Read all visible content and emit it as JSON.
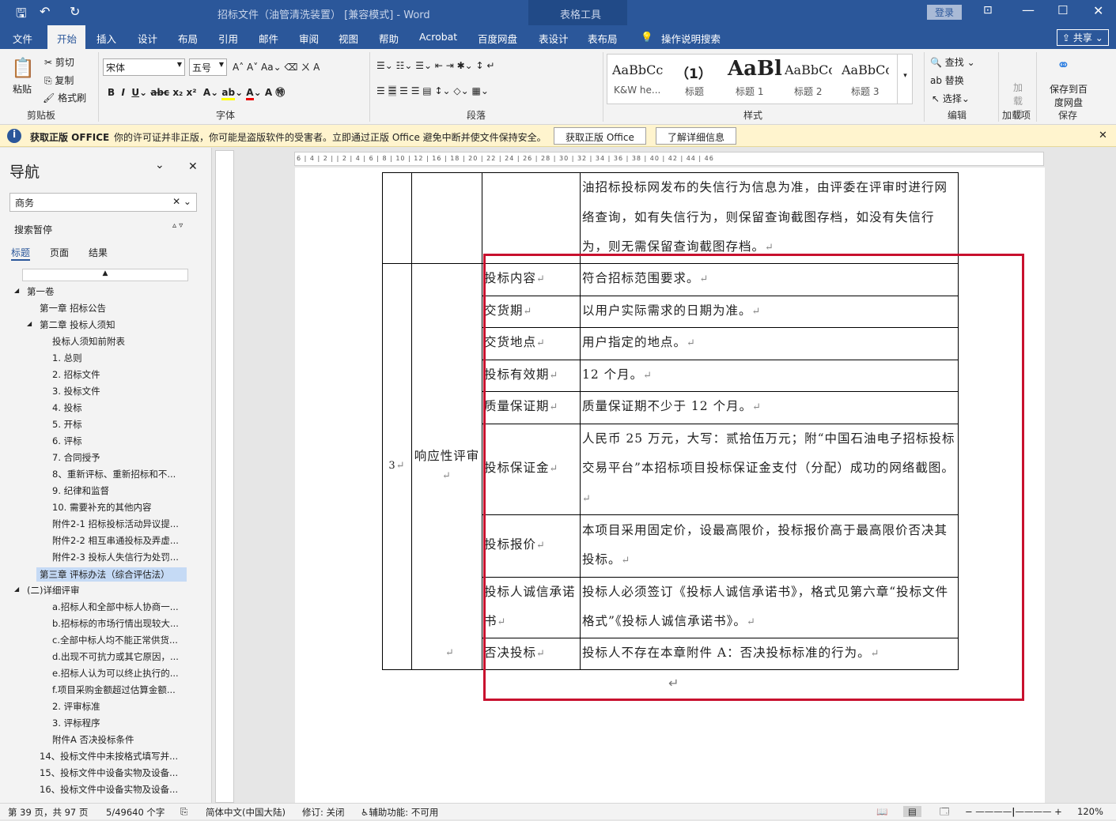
{
  "titlebar": {
    "title": "招标文件（油管清洗装置） [兼容模式] - Word",
    "context_tab": "表格工具",
    "signin": "登录"
  },
  "tabs": [
    "文件",
    "开始",
    "插入",
    "设计",
    "布局",
    "引用",
    "邮件",
    "审阅",
    "视图",
    "帮助",
    "Acrobat",
    "百度网盘",
    "表设计",
    "表布局"
  ],
  "tell_me": "操作说明搜索",
  "share": "共享",
  "ribbon": {
    "clipboard": {
      "paste": "粘贴",
      "cut": "剪切",
      "copy": "复制",
      "format_painter": "格式刷",
      "label": "剪贴板"
    },
    "font": {
      "name": "宋体",
      "size": "五号",
      "label": "字体"
    },
    "paragraph": {
      "label": "段落"
    },
    "styles": {
      "items": [
        {
          "preview": "AaBbCc",
          "name": "K&W he..."
        },
        {
          "preview": "（1）",
          "name": "标题"
        },
        {
          "preview": "AaBl",
          "name": "标题 1"
        },
        {
          "preview": "AaBbCc",
          "name": "标题 2"
        },
        {
          "preview": "AaBbCc",
          "name": "标题 3"
        }
      ],
      "label": "样式"
    },
    "editing": {
      "find": "查找",
      "replace": "替换",
      "select": "选择",
      "label": "编辑"
    },
    "addins": {
      "btn": "加载项",
      "label": "加载项"
    },
    "save": {
      "btn": "保存到百度网盘",
      "label": "保存"
    }
  },
  "infobar": {
    "title": "获取正版 OFFICE",
    "message": "你的许可证并非正版，你可能是盗版软件的受害者。立即通过正版 Office 避免中断并使文件保持安全。",
    "btn1": "获取正版 Office",
    "btn2": "了解详细信息"
  },
  "nav": {
    "title": "导航",
    "search": "商务",
    "results_label": "搜索暂停",
    "tabs": [
      "标题",
      "页面",
      "结果"
    ],
    "items": [
      {
        "t": "第一卷",
        "l": 0,
        "exp": true
      },
      {
        "t": "第一章  招标公告",
        "l": 1
      },
      {
        "t": "第二章  投标人须知",
        "l": 1,
        "exp": true
      },
      {
        "t": "投标人须知前附表",
        "l": 2
      },
      {
        "t": "1. 总则",
        "l": 2
      },
      {
        "t": "2. 招标文件",
        "l": 2
      },
      {
        "t": "3. 投标文件",
        "l": 2
      },
      {
        "t": "4. 投标",
        "l": 2
      },
      {
        "t": "5. 开标",
        "l": 2
      },
      {
        "t": "6. 评标",
        "l": 2
      },
      {
        "t": "7. 合同授予",
        "l": 2
      },
      {
        "t": "8、重新评标、重新招标和不...",
        "l": 2
      },
      {
        "t": "9. 纪律和监督",
        "l": 2
      },
      {
        "t": "10. 需要补充的其他内容",
        "l": 2
      },
      {
        "t": "附件2-1 招标投标活动异议提...",
        "l": 2
      },
      {
        "t": "附件2-2 相互串通投标及弄虚...",
        "l": 2
      },
      {
        "t": "附件2-3 投标人失信行为处罚...",
        "l": 2
      },
      {
        "t": "第三章  评标办法（综合评估法）",
        "l": 1,
        "sel": true
      },
      {
        "t": "(二)详细评审",
        "l": 0,
        "exp": true
      },
      {
        "t": "a.招标人和全部中标人协商一...",
        "l": 2
      },
      {
        "t": "b.招标标的市场行情出现较大...",
        "l": 2
      },
      {
        "t": "c.全部中标人均不能正常供货...",
        "l": 2
      },
      {
        "t": "d.出现不可抗力或其它原因，...",
        "l": 2
      },
      {
        "t": "e.招标人认为可以终止执行的...",
        "l": 2
      },
      {
        "t": "f.项目采购金额超过估算金额...",
        "l": 2
      },
      {
        "t": "2. 评审标准",
        "l": 2
      },
      {
        "t": "3. 评标程序",
        "l": 2
      },
      {
        "t": "附件A 否决投标条件",
        "l": 2
      },
      {
        "t": "14、投标文件中未按格式填写并...",
        "l": 1
      },
      {
        "t": "15、投标文件中设备实物及设备...",
        "l": 1
      },
      {
        "t": "16、投标文件中设备实物及设备...",
        "l": 1
      }
    ]
  },
  "ruler": "6 | 4 | 2 | | 2 | 4 | 6 | 8 | 10 | 12 | 16 | 18 | 20 | 22 | 24 | 26 | 28 | 30 | 32 | 34 | 36 | 38 | 40 | 42 | 44 | 46",
  "table": {
    "top_text": "油招标投标网发布的失信行为信息为准，由评委在评审时进行网络查询，如有失信行为，则保留查询截图存档，如没有失信行为，则无需保留查询截图存档。",
    "index": "3",
    "category": "响应性评审",
    "rows": [
      {
        "item": "投标内容",
        "req": "符合招标范围要求。"
      },
      {
        "item": "交货期",
        "req": "以用户实际需求的日期为准。"
      },
      {
        "item": "交货地点",
        "req": "用户指定的地点。"
      },
      {
        "item": "投标有效期",
        "req": "12 个月。"
      },
      {
        "item": "质量保证期",
        "req": "质量保证期不少于 12 个月。"
      },
      {
        "item": "投标保证金",
        "req": "人民币 25 万元，大写：贰拾伍万元；附“中国石油电子招标投标交易平台”本招标项目投标保证金支付（分配）成功的网络截图。"
      },
      {
        "item": "投标报价",
        "req": "本项目采用固定价，设最高限价，投标报价高于最高限价否决其投标。"
      },
      {
        "item": "投标人诚信承诺书",
        "req": "投标人必须签订《投标人诚信承诺书》，格式见第六章“投标文件格式”《投标人诚信承诺书》。"
      },
      {
        "item": "否决投标",
        "req": "投标人不存在本章附件 A：否决投标标准的行为。"
      }
    ],
    "para_mark": "↵"
  },
  "status": {
    "page": "第 39 页，共 97 页",
    "words": "5/49640 个字",
    "lang": "简体中文(中国大陆)",
    "track": "修订: 关闭",
    "access": "辅助功能: 不可用",
    "zoom": "120%"
  },
  "colors": {
    "brand": "#2b579a",
    "highlight": "#c8102e"
  }
}
